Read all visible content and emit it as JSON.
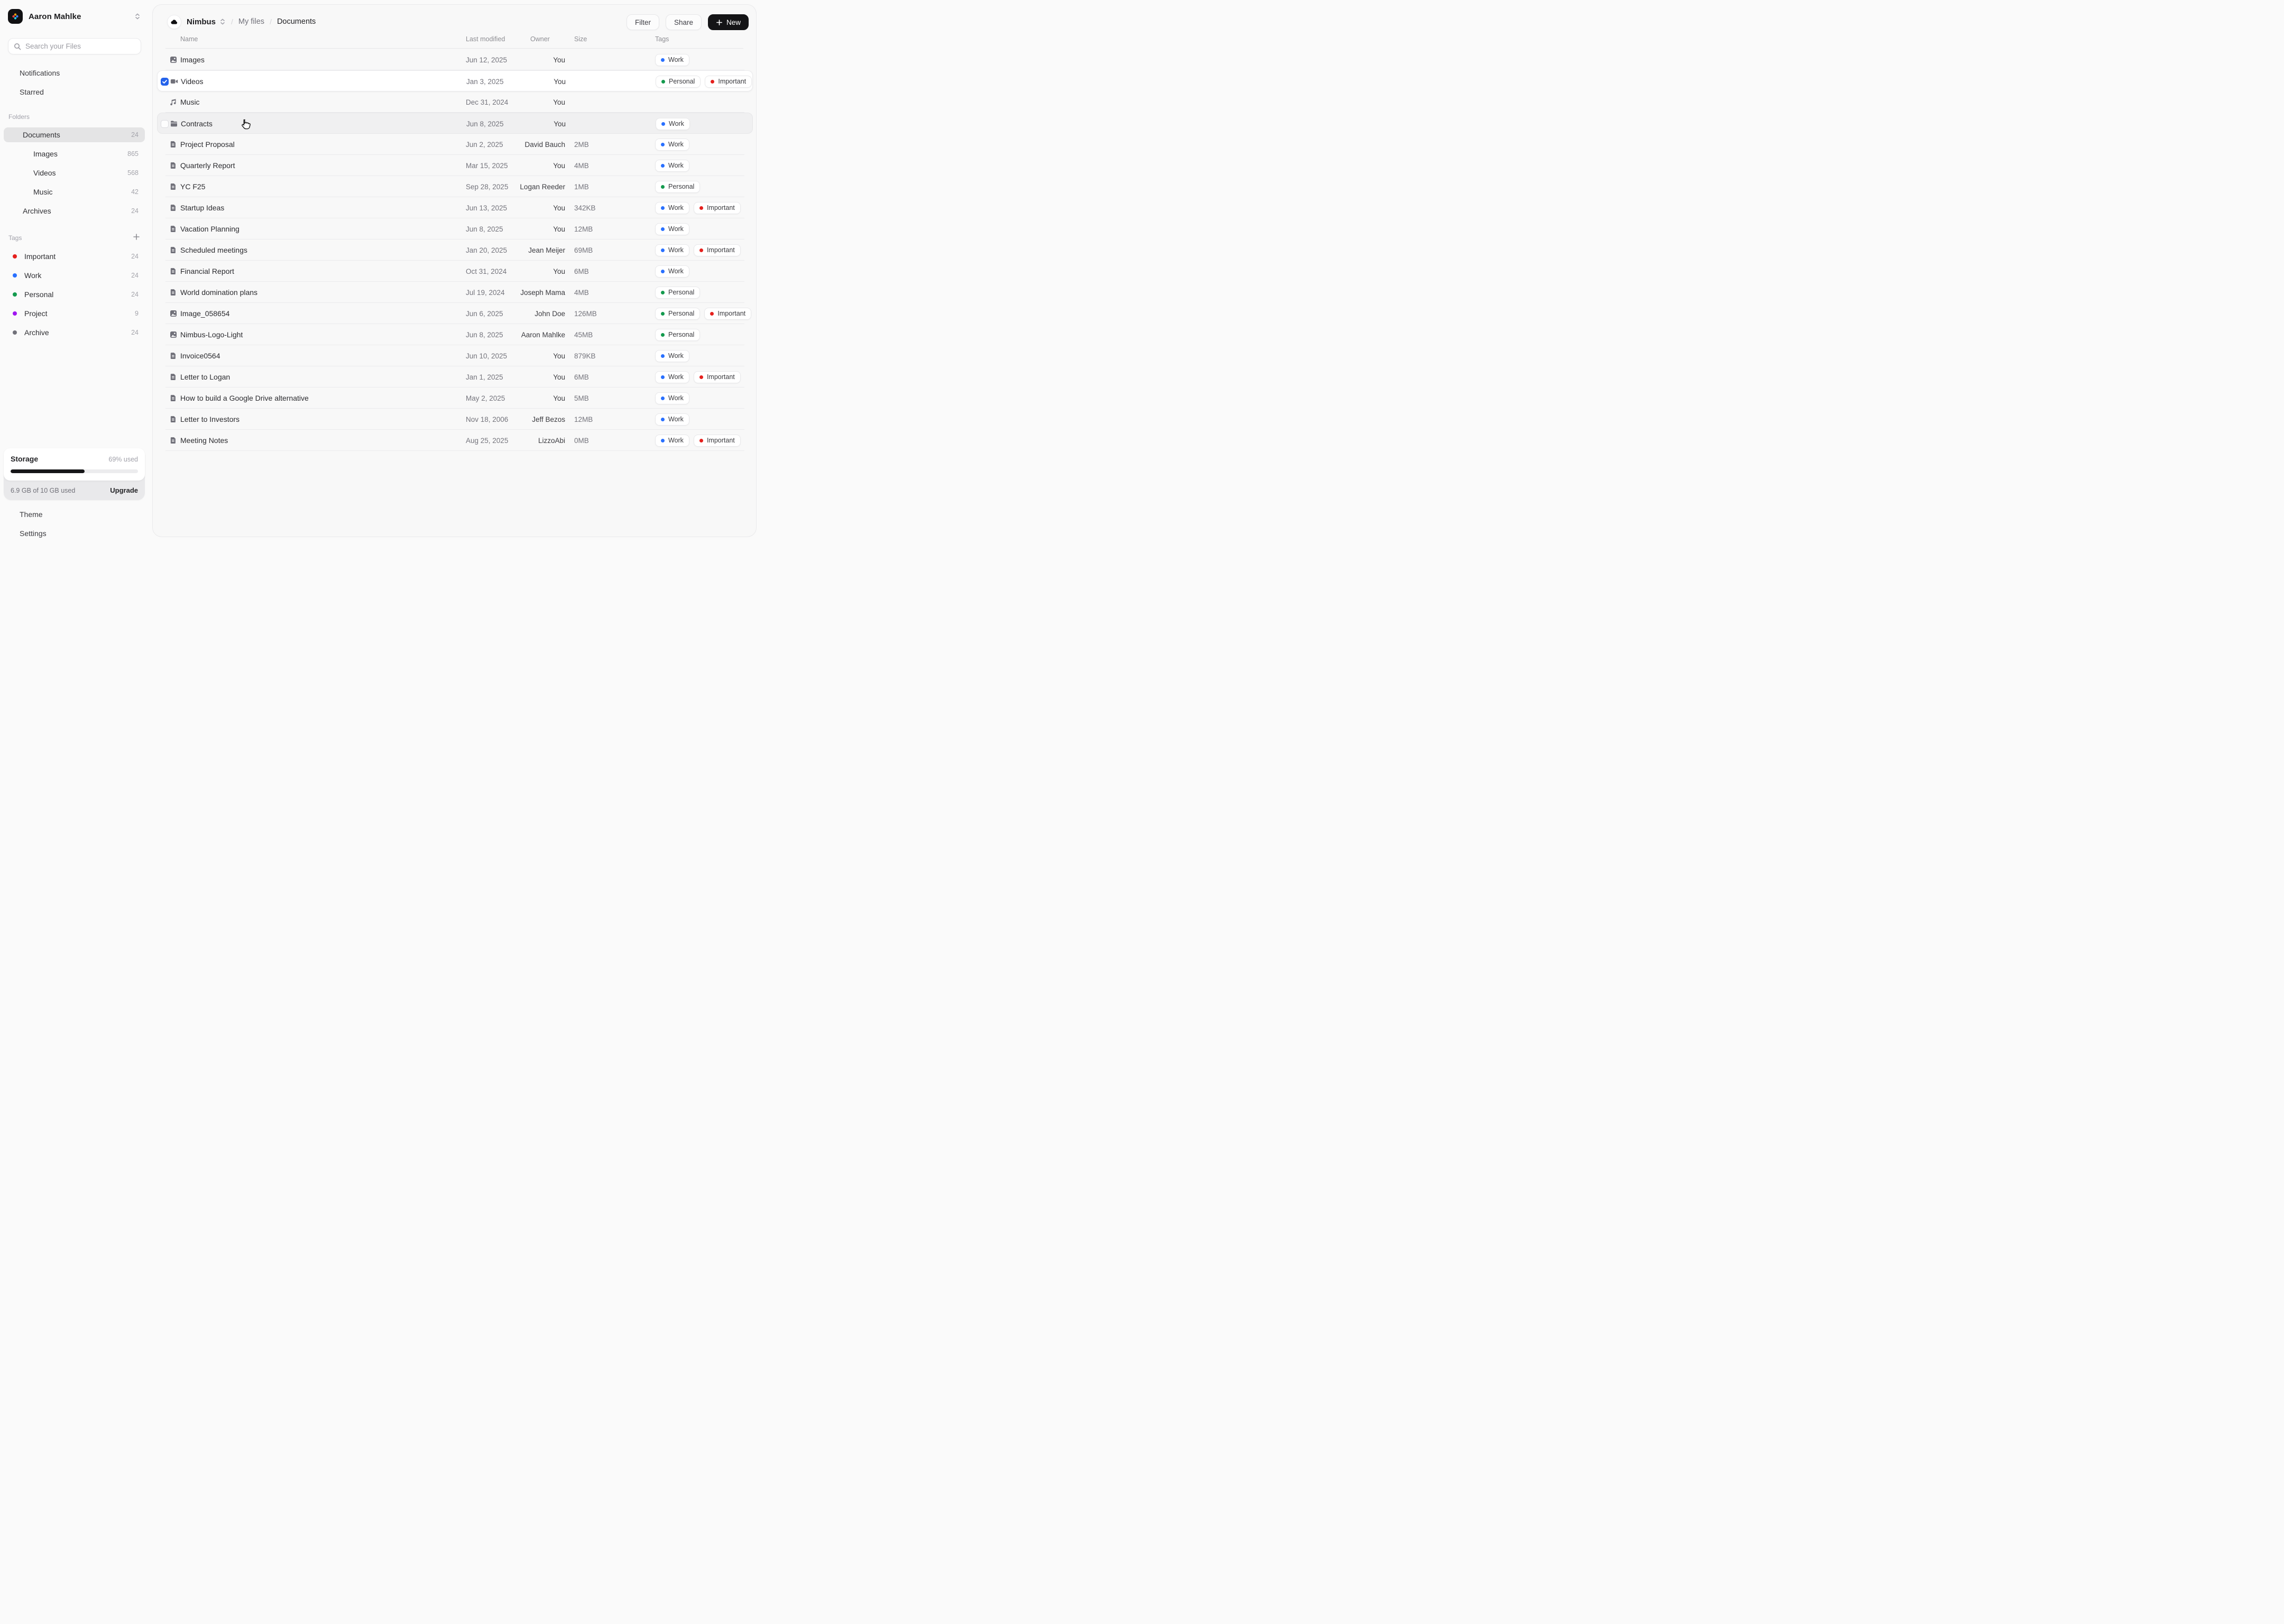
{
  "sidebar": {
    "user": {
      "name": "Aaron Mahlke"
    },
    "search": {
      "placeholder": "Search your Files"
    },
    "nav": [
      {
        "label": "Notifications",
        "icon": "bell"
      },
      {
        "label": "Starred",
        "icon": "star"
      }
    ],
    "folders_label": "Folders",
    "folders": [
      {
        "label": "Documents",
        "count": "24",
        "icon": "folder",
        "level": 0,
        "chevron": "down",
        "active": true
      },
      {
        "label": "Images",
        "count": "865",
        "icon": "image",
        "level": 1,
        "chevron": "right",
        "active": false
      },
      {
        "label": "Videos",
        "count": "568",
        "icon": "video",
        "level": 1,
        "chevron": "right",
        "active": false
      },
      {
        "label": "Music",
        "count": "42",
        "icon": "music",
        "level": 1,
        "chevron": "right",
        "active": false
      },
      {
        "label": "Archives",
        "count": "24",
        "icon": "archive",
        "level": 0,
        "chevron": "right",
        "active": false
      }
    ],
    "tags_label": "Tags",
    "tags": [
      {
        "label": "Important",
        "count": "24",
        "color": "#e5201d"
      },
      {
        "label": "Work",
        "count": "24",
        "color": "#2970ff"
      },
      {
        "label": "Personal",
        "count": "24",
        "color": "#149a4e"
      },
      {
        "label": "Project",
        "count": "9",
        "color": "#a016f0"
      },
      {
        "label": "Archive",
        "count": "24",
        "color": "#71717a"
      }
    ],
    "storage": {
      "title": "Storage",
      "used_label": "69% used",
      "bar_percent": 58,
      "usage_label": "6.9 GB of 10 GB used",
      "upgrade_label": "Upgrade"
    },
    "footer": [
      {
        "label": "Theme",
        "icon": "sun"
      },
      {
        "label": "Settings",
        "icon": "gear"
      }
    ]
  },
  "topbar": {
    "workspace": "Nimbus",
    "separator": "/",
    "breadcrumbs": [
      "My files",
      "Documents"
    ],
    "buttons": {
      "filter": "Filter",
      "share": "Share",
      "new": "New"
    }
  },
  "table": {
    "columns": {
      "name": "Name",
      "modified": "Last modified",
      "owner": "Owner",
      "size": "Size",
      "tags": "Tags"
    },
    "tag_colors": {
      "Work": "#2970ff",
      "Personal": "#149a4e",
      "Important": "#e5201d"
    },
    "rows": [
      {
        "name": "Images",
        "icon": "image",
        "modified": "Jun 12, 2025",
        "owner": "You",
        "size": "",
        "tags": [
          "Work"
        ],
        "state": ""
      },
      {
        "name": "Videos",
        "icon": "video",
        "modified": "Jan 3, 2025",
        "owner": "You",
        "size": "",
        "tags": [
          "Personal",
          "Important"
        ],
        "state": "selected",
        "checked": true
      },
      {
        "name": "Music",
        "icon": "music",
        "modified": "Dec 31, 2024",
        "owner": "You",
        "size": "",
        "tags": [],
        "state": ""
      },
      {
        "name": "Contracts",
        "icon": "folder",
        "modified": "Jun 8, 2025",
        "owner": "You",
        "size": "",
        "tags": [
          "Work"
        ],
        "state": "hover",
        "checked": false
      },
      {
        "name": "Project Proposal",
        "icon": "doc",
        "modified": "Jun 2, 2025",
        "owner": "David Bauch",
        "size": "2MB",
        "tags": [
          "Work"
        ],
        "state": ""
      },
      {
        "name": "Quarterly Report",
        "icon": "doc",
        "modified": "Mar 15, 2025",
        "owner": "You",
        "size": "4MB",
        "tags": [
          "Work"
        ],
        "state": ""
      },
      {
        "name": "YC F25",
        "icon": "doc",
        "modified": "Sep 28, 2025",
        "owner": "Logan Reeder",
        "size": "1MB",
        "tags": [
          "Personal"
        ],
        "state": ""
      },
      {
        "name": "Startup Ideas",
        "icon": "doc",
        "modified": "Jun 13, 2025",
        "owner": "You",
        "size": "342KB",
        "tags": [
          "Work",
          "Important"
        ],
        "state": ""
      },
      {
        "name": "Vacation Planning",
        "icon": "doc",
        "modified": "Jun 8, 2025",
        "owner": "You",
        "size": "12MB",
        "tags": [
          "Work"
        ],
        "state": ""
      },
      {
        "name": "Scheduled meetings",
        "icon": "doc",
        "modified": "Jan 20, 2025",
        "owner": "Jean Meijer",
        "size": "69MB",
        "tags": [
          "Work",
          "Important"
        ],
        "state": ""
      },
      {
        "name": "Financial Report",
        "icon": "doc",
        "modified": "Oct 31, 2024",
        "owner": "You",
        "size": "6MB",
        "tags": [
          "Work"
        ],
        "state": ""
      },
      {
        "name": "World domination plans",
        "icon": "doc",
        "modified": "Jul 19, 2024",
        "owner": "Joseph Mama",
        "size": "4MB",
        "tags": [
          "Personal"
        ],
        "state": ""
      },
      {
        "name": "Image_058654",
        "icon": "image",
        "modified": "Jun 6, 2025",
        "owner": "John Doe",
        "size": "126MB",
        "tags": [
          "Personal",
          "Important"
        ],
        "state": ""
      },
      {
        "name": "Nimbus-Logo-Light",
        "icon": "image",
        "modified": "Jun 8, 2025",
        "owner": "Aaron Mahlke",
        "size": "45MB",
        "tags": [
          "Personal"
        ],
        "state": ""
      },
      {
        "name": "Invoice0564",
        "icon": "doc",
        "modified": "Jun 10, 2025",
        "owner": "You",
        "size": "879KB",
        "tags": [
          "Work"
        ],
        "state": ""
      },
      {
        "name": "Letter to Logan",
        "icon": "doc",
        "modified": "Jan 1, 2025",
        "owner": "You",
        "size": "6MB",
        "tags": [
          "Work",
          "Important"
        ],
        "state": ""
      },
      {
        "name": "How to build a Google Drive alternative",
        "icon": "doc",
        "modified": "May 2, 2025",
        "owner": "You",
        "size": "5MB",
        "tags": [
          "Work"
        ],
        "state": ""
      },
      {
        "name": "Letter to Investors",
        "icon": "doc",
        "modified": "Nov 18, 2006",
        "owner": "Jeff Bezos",
        "size": "12MB",
        "tags": [
          "Work"
        ],
        "state": ""
      },
      {
        "name": "Meeting Notes",
        "icon": "doc",
        "modified": "Aug 25, 2025",
        "owner": "LizzoAbi",
        "size": "0MB",
        "tags": [
          "Work",
          "Important"
        ],
        "state": ""
      }
    ]
  },
  "cursor": {
    "type": "pointer-hand"
  }
}
